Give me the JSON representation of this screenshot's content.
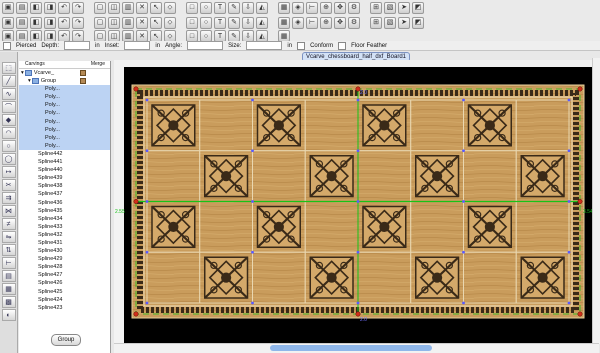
{
  "toolbars": {
    "row1": [
      "new-icon",
      "open-icon",
      "save-icon",
      "print-icon",
      "undo-icon",
      "redo-icon",
      "cut-icon",
      "copy-icon",
      "paste-icon",
      "delete-icon",
      "select-icon",
      "node-icon",
      "rect-icon",
      "circle-icon",
      "text-icon",
      "pen-icon",
      "import-icon",
      "shape-icon",
      "library-icon",
      "fill-icon",
      "measure-icon",
      "zoom-icon",
      "pan-icon",
      "wrench-icon",
      "snap-icon",
      "grid-icon",
      "arrow-icon",
      "3d-icon"
    ],
    "row2": [
      "layers-icon",
      "mirror-icon",
      "align-icon",
      "group-icon",
      "ungroup-icon",
      "weld-icon",
      "trim-icon",
      "offset-icon",
      "scale-icon",
      "rotate-icon",
      "flip-icon",
      "array-icon",
      "node-edit-icon",
      "join-icon",
      "break-icon",
      "smooth-icon",
      "vcarve-icon",
      "pocket-icon",
      "fillet-icon",
      "chamfer-icon",
      "engrave-icon",
      "drill-icon",
      "texture-icon",
      "preview-icon",
      "simulate-icon",
      "toolpath-icon",
      "settings-icon",
      "info-icon"
    ],
    "row3": [
      "mode-a-icon",
      "mode-b-icon",
      "mode-c-icon",
      "mode-d-icon",
      "mode-e-icon",
      "mode-f-icon",
      "mode-g-icon",
      "mode-h-icon",
      "mode-i-icon",
      "mode-j-icon",
      "mode-k-icon",
      "mode-l-icon",
      "mode-m-icon",
      "mode-n-icon",
      "mode-o-icon",
      "mode-p-icon",
      "mode-q-icon",
      "mode-r-icon",
      "mode-s-icon"
    ]
  },
  "options": {
    "pierced": "Pierced",
    "depth": "Depth:",
    "depth_unit": "in",
    "inset": "Inset:",
    "inset_unit": "in",
    "angle": "Angle:",
    "size": "Size:",
    "size_unit": "in",
    "conform": "Conform",
    "floor_feather": "Floor Feather"
  },
  "document_tab": "Vcarve_chessboard_half_dxf_Board1",
  "panel": {
    "col_carvings": "Carvings",
    "col_merge": "Merge",
    "root": "Vcarve_",
    "group": "Group",
    "poly_label": "Poly...",
    "poly_count": 8,
    "splines": [
      "Spline442",
      "Spline441",
      "Spline440",
      "Spline439",
      "Spline438",
      "Spline437",
      "Spline436",
      "Spline435",
      "Spline434",
      "Spline433",
      "Spline432",
      "Spline431",
      "Spline430",
      "Spline429",
      "Spline428",
      "Spline427",
      "Spline426",
      "Spline425",
      "Spline424",
      "Spline423"
    ],
    "group_button": "Group"
  },
  "canvas": {
    "left_dim": "2.55",
    "right_dim": "3.54",
    "top_marker": "2.0",
    "bottom_marker": "2.0",
    "colors": {
      "wood": "#caa062",
      "dark_tile": "#3a2a18",
      "selection": "#17c217",
      "background": "#000000"
    },
    "grid": {
      "columns": 8,
      "rows": 4,
      "pattern": "checker"
    }
  }
}
